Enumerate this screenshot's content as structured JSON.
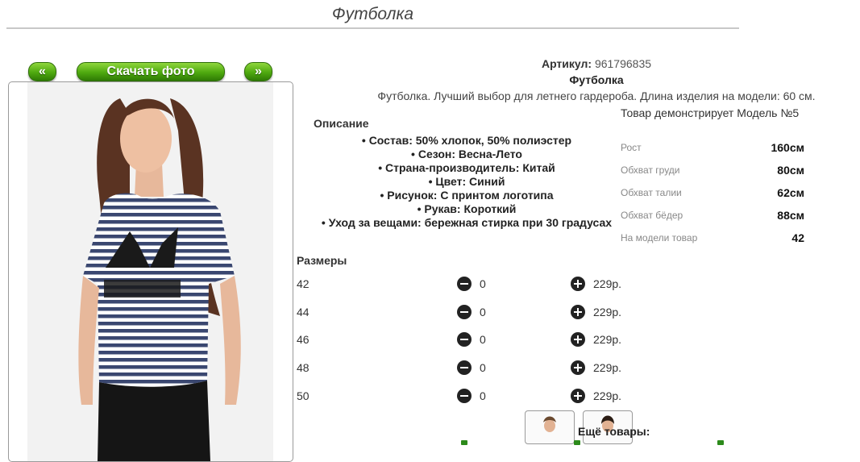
{
  "page": {
    "title": "Футболка"
  },
  "gallery": {
    "prev_label": "«",
    "download_label": "Скачать фото",
    "next_label": "»"
  },
  "product": {
    "article_label": "Артикул:",
    "article_value": "961796835",
    "name": "Футболка",
    "short_description": "Футболка. Лучший выбор для летнего гардероба. Длина изделия на модели: 60 см."
  },
  "description": {
    "heading": "Описание",
    "items": [
      "Состав: 50% хлопок, 50% полиэстер",
      "Сезон: Весна-Лето",
      "Страна-производитель: Китай",
      "Цвет: Синий",
      "Рисунок: С принтом логотипа",
      "Рукав: Короткий",
      "Уход за вещами: бережная стирка при 30 градусах"
    ]
  },
  "model": {
    "note": "Товар демонстрирует Модель №5",
    "params": [
      {
        "label": "Рост",
        "value": "160см"
      },
      {
        "label": "Обхват груди",
        "value": "80см"
      },
      {
        "label": "Обхват талии",
        "value": "62см"
      },
      {
        "label": "Обхват бёдер",
        "value": "88см"
      },
      {
        "label": "На модели товар",
        "value": "42"
      }
    ]
  },
  "sizes": {
    "heading": "Размеры",
    "rows": [
      {
        "size": "42",
        "qty": "0",
        "price": "229р."
      },
      {
        "size": "44",
        "qty": "0",
        "price": "229р."
      },
      {
        "size": "46",
        "qty": "0",
        "price": "229р."
      },
      {
        "size": "48",
        "qty": "0",
        "price": "229р."
      },
      {
        "size": "50",
        "qty": "0",
        "price": "229р."
      }
    ]
  },
  "more": {
    "heading": "Ещё товары:"
  },
  "colors": {
    "accent_green": "#4ea90f",
    "link_green": "#2c8a1b",
    "stripe_navy": "#3a4770"
  }
}
